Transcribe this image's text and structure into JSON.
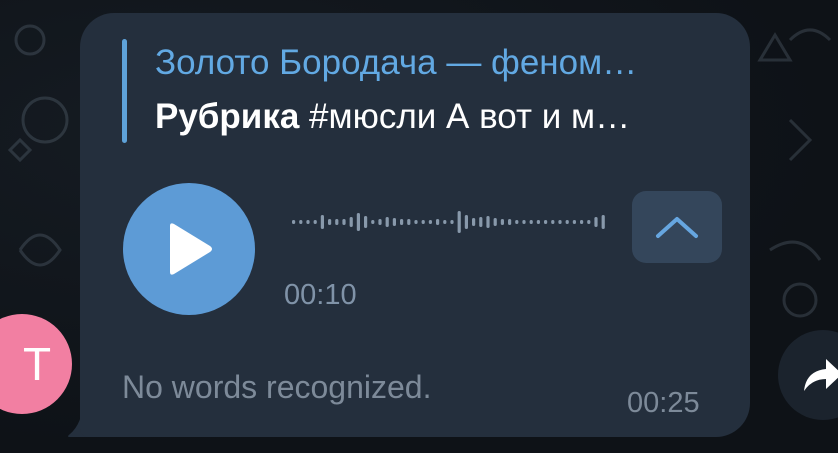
{
  "sender": {
    "avatar_letter": "T",
    "avatar_color": "#f27fa2"
  },
  "reply": {
    "title": "Золото Бородача — феном…",
    "text_bold": "Рубрика",
    "text_rest": " #мюсли  А вот и м…"
  },
  "voice_message": {
    "current_position": "00:10",
    "play_icon": "play-icon",
    "transcribe_icon": "chevron-up-icon"
  },
  "transcription": {
    "text": "No words recognized."
  },
  "message": {
    "time": "00:25"
  },
  "actions": {
    "forward_icon": "forward-arrow-icon"
  },
  "colors": {
    "bubble": "#242f3d",
    "accent": "#5d9bd6",
    "reply_title": "#62a9e3",
    "secondary_text": "#7d8a99"
  }
}
